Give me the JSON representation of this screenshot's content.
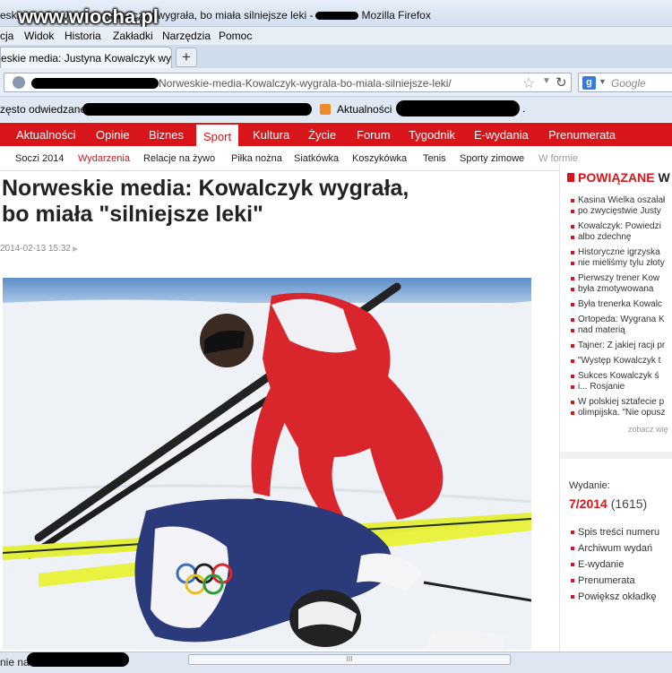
{
  "window": {
    "title_prefix": "eskie media: Justyna Kowalczyk wygrała, bo miała silniejsze leki -",
    "title_suffix": "Mozilla Firefox",
    "watermark": "www.wiocha.pl"
  },
  "menu": [
    "cja",
    "Widok",
    "Historia",
    "Zakładki",
    "Narzędzia",
    "Pomoc"
  ],
  "tab": {
    "label": "eskie media: Justyna Kowalczyk wy...",
    "new_tab": "+"
  },
  "urlbar": {
    "url": "Norweskie-media-Kowalczyk-wygrala-bo-miala-silniejsze-leki/",
    "search_placeholder": "Google",
    "search_engine": "g"
  },
  "bookmarks": {
    "most_visited": "zęsto odwiedzane",
    "news": "Aktualności"
  },
  "site_nav": {
    "items": [
      "Aktualności",
      "Opinie",
      "Biznes",
      "Sport",
      "Kultura",
      "Życie",
      "Forum",
      "Tygodnik",
      "E-wydania",
      "Prenumerata"
    ],
    "active": "Sport"
  },
  "sub_nav": {
    "items": [
      "Soczi 2014",
      "Wydarzenia",
      "Relacje na żywo",
      "Piłka nożna",
      "Siatkówka",
      "Koszykówka",
      "Tenis",
      "Sporty zimowe",
      "W formie"
    ],
    "active": "Wydarzenia"
  },
  "article": {
    "headline_line1": "Norweskie media: Kowalczyk wygrała,",
    "headline_line2": "bo miała \"silniejsze leki\"",
    "date": "2014-02-13 15:32"
  },
  "sidebar": {
    "heading": "POWIĄZANE",
    "heading_tail": "W",
    "related": [
      "Kasina Wielka oszalał",
      "po zwycięstwie Justy",
      "Kowalczyk: Powiedzi",
      "albo zdechnę",
      "Historyczne igrzyska",
      "nie mieliśmy tylu złoty",
      "Pierwszy trener Kow",
      "była zmotywowana",
      "Była trenerka Kowalc",
      "Ortopeda: Wygrana K",
      "nad materią",
      "Tajner: Z jakiej racji pr",
      "\"Występ Kowalczyk t",
      "Sukces Kowalczyk ś",
      "i... Rosjanie",
      "W polskiej sztafecie p",
      "olimpijska. \"Nie opusz"
    ],
    "more": "zobacz wię",
    "issue_label": "Wydanie:",
    "issue_number": "7/2014",
    "issue_count": "(1615)",
    "issue_links": [
      "Spis treści numeru",
      "Archiwum wydań",
      "E-wydanie",
      "Prenumerata",
      "Powiększ okładkę"
    ]
  },
  "status": {
    "text": "nie na",
    "scroll_grip": "III"
  }
}
